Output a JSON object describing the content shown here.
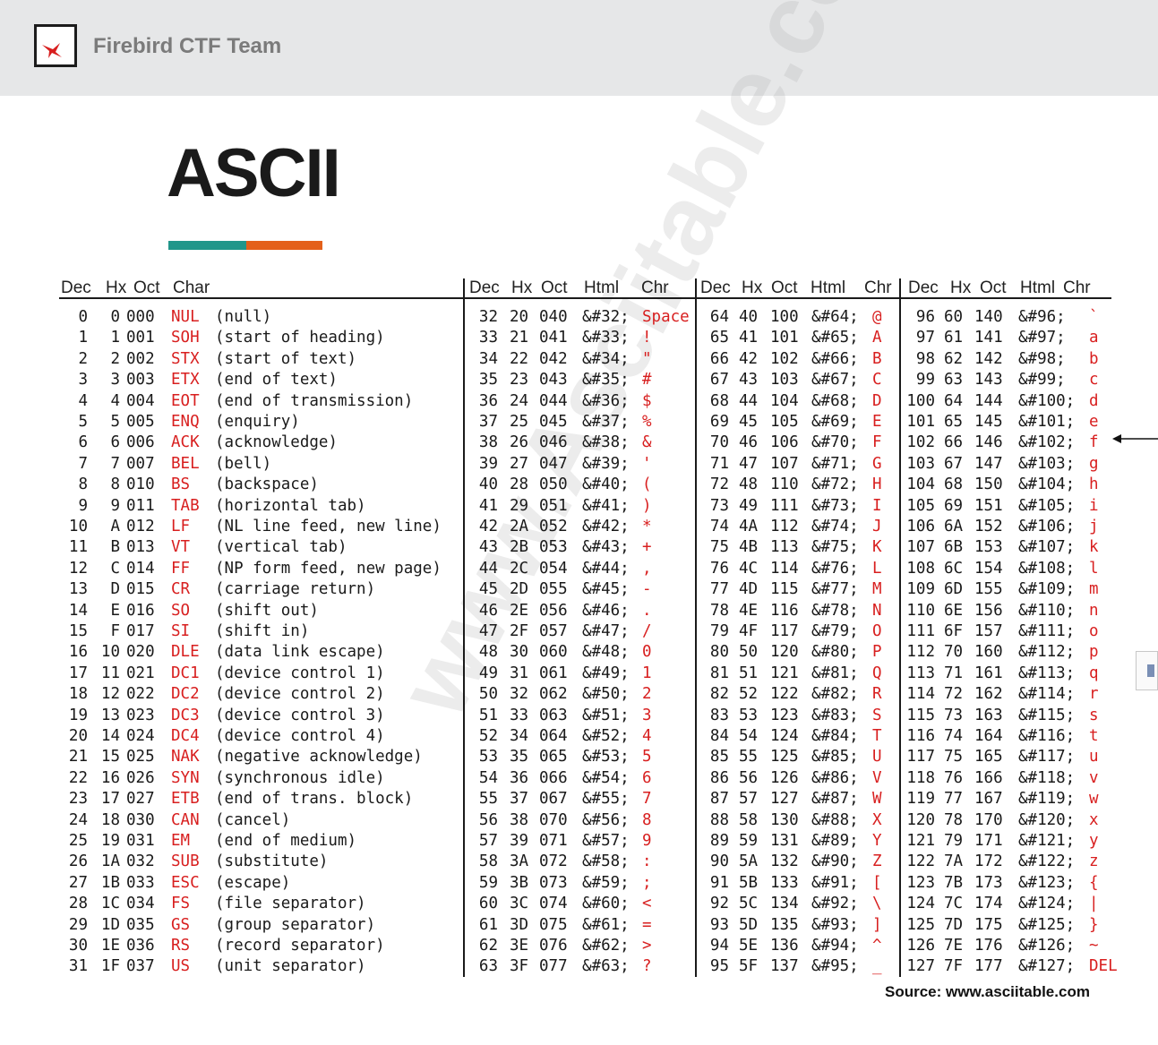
{
  "header": {
    "team_name": "Firebird CTF Team"
  },
  "title": "ASCII",
  "table": {
    "headers": [
      [
        "Dec",
        "Hx",
        "Oct",
        "Char",
        ""
      ],
      [
        "Dec",
        "Hx",
        "Oct",
        "Html",
        "Chr"
      ],
      [
        "Dec",
        "Hx",
        "Oct",
        "Html",
        "Chr"
      ],
      [
        "Dec",
        "Hx",
        "Oct",
        "Html",
        "Chr"
      ]
    ],
    "control": [
      [
        "0",
        "0",
        "000",
        "NUL",
        "(null)"
      ],
      [
        "1",
        "1",
        "001",
        "SOH",
        "(start of heading)"
      ],
      [
        "2",
        "2",
        "002",
        "STX",
        "(start of text)"
      ],
      [
        "3",
        "3",
        "003",
        "ETX",
        "(end of text)"
      ],
      [
        "4",
        "4",
        "004",
        "EOT",
        "(end of transmission)"
      ],
      [
        "5",
        "5",
        "005",
        "ENQ",
        "(enquiry)"
      ],
      [
        "6",
        "6",
        "006",
        "ACK",
        "(acknowledge)"
      ],
      [
        "7",
        "7",
        "007",
        "BEL",
        "(bell)"
      ],
      [
        "8",
        "8",
        "010",
        "BS",
        "(backspace)"
      ],
      [
        "9",
        "9",
        "011",
        "TAB",
        "(horizontal tab)"
      ],
      [
        "10",
        "A",
        "012",
        "LF",
        "(NL line feed, new line)"
      ],
      [
        "11",
        "B",
        "013",
        "VT",
        "(vertical tab)"
      ],
      [
        "12",
        "C",
        "014",
        "FF",
        "(NP form feed, new page)"
      ],
      [
        "13",
        "D",
        "015",
        "CR",
        "(carriage return)"
      ],
      [
        "14",
        "E",
        "016",
        "SO",
        "(shift out)"
      ],
      [
        "15",
        "F",
        "017",
        "SI",
        "(shift in)"
      ],
      [
        "16",
        "10",
        "020",
        "DLE",
        "(data link escape)"
      ],
      [
        "17",
        "11",
        "021",
        "DC1",
        "(device control 1)"
      ],
      [
        "18",
        "12",
        "022",
        "DC2",
        "(device control 2)"
      ],
      [
        "19",
        "13",
        "023",
        "DC3",
        "(device control 3)"
      ],
      [
        "20",
        "14",
        "024",
        "DC4",
        "(device control 4)"
      ],
      [
        "21",
        "15",
        "025",
        "NAK",
        "(negative acknowledge)"
      ],
      [
        "22",
        "16",
        "026",
        "SYN",
        "(synchronous idle)"
      ],
      [
        "23",
        "17",
        "027",
        "ETB",
        "(end of trans. block)"
      ],
      [
        "24",
        "18",
        "030",
        "CAN",
        "(cancel)"
      ],
      [
        "25",
        "19",
        "031",
        "EM",
        "(end of medium)"
      ],
      [
        "26",
        "1A",
        "032",
        "SUB",
        "(substitute)"
      ],
      [
        "27",
        "1B",
        "033",
        "ESC",
        "(escape)"
      ],
      [
        "28",
        "1C",
        "034",
        "FS",
        "(file separator)"
      ],
      [
        "29",
        "1D",
        "035",
        "GS",
        "(group separator)"
      ],
      [
        "30",
        "1E",
        "036",
        "RS",
        "(record separator)"
      ],
      [
        "31",
        "1F",
        "037",
        "US",
        "(unit separator)"
      ]
    ],
    "printable": [
      [
        [
          "32",
          "20",
          "040",
          "&#32;",
          "Space"
        ],
        [
          "33",
          "21",
          "041",
          "&#33;",
          "!"
        ],
        [
          "34",
          "22",
          "042",
          "&#34;",
          "\""
        ],
        [
          "35",
          "23",
          "043",
          "&#35;",
          "#"
        ],
        [
          "36",
          "24",
          "044",
          "&#36;",
          "$"
        ],
        [
          "37",
          "25",
          "045",
          "&#37;",
          "%"
        ],
        [
          "38",
          "26",
          "046",
          "&#38;",
          "&"
        ],
        [
          "39",
          "27",
          "047",
          "&#39;",
          "'"
        ],
        [
          "40",
          "28",
          "050",
          "&#40;",
          "("
        ],
        [
          "41",
          "29",
          "051",
          "&#41;",
          ")"
        ],
        [
          "42",
          "2A",
          "052",
          "&#42;",
          "*"
        ],
        [
          "43",
          "2B",
          "053",
          "&#43;",
          "+"
        ],
        [
          "44",
          "2C",
          "054",
          "&#44;",
          ","
        ],
        [
          "45",
          "2D",
          "055",
          "&#45;",
          "-"
        ],
        [
          "46",
          "2E",
          "056",
          "&#46;",
          "."
        ],
        [
          "47",
          "2F",
          "057",
          "&#47;",
          "/"
        ],
        [
          "48",
          "30",
          "060",
          "&#48;",
          "0"
        ],
        [
          "49",
          "31",
          "061",
          "&#49;",
          "1"
        ],
        [
          "50",
          "32",
          "062",
          "&#50;",
          "2"
        ],
        [
          "51",
          "33",
          "063",
          "&#51;",
          "3"
        ],
        [
          "52",
          "34",
          "064",
          "&#52;",
          "4"
        ],
        [
          "53",
          "35",
          "065",
          "&#53;",
          "5"
        ],
        [
          "54",
          "36",
          "066",
          "&#54;",
          "6"
        ],
        [
          "55",
          "37",
          "067",
          "&#55;",
          "7"
        ],
        [
          "56",
          "38",
          "070",
          "&#56;",
          "8"
        ],
        [
          "57",
          "39",
          "071",
          "&#57;",
          "9"
        ],
        [
          "58",
          "3A",
          "072",
          "&#58;",
          ":"
        ],
        [
          "59",
          "3B",
          "073",
          "&#59;",
          ";"
        ],
        [
          "60",
          "3C",
          "074",
          "&#60;",
          "<"
        ],
        [
          "61",
          "3D",
          "075",
          "&#61;",
          "="
        ],
        [
          "62",
          "3E",
          "076",
          "&#62;",
          ">"
        ],
        [
          "63",
          "3F",
          "077",
          "&#63;",
          "?"
        ]
      ],
      [
        [
          "64",
          "40",
          "100",
          "&#64;",
          "@"
        ],
        [
          "65",
          "41",
          "101",
          "&#65;",
          "A"
        ],
        [
          "66",
          "42",
          "102",
          "&#66;",
          "B"
        ],
        [
          "67",
          "43",
          "103",
          "&#67;",
          "C"
        ],
        [
          "68",
          "44",
          "104",
          "&#68;",
          "D"
        ],
        [
          "69",
          "45",
          "105",
          "&#69;",
          "E"
        ],
        [
          "70",
          "46",
          "106",
          "&#70;",
          "F"
        ],
        [
          "71",
          "47",
          "107",
          "&#71;",
          "G"
        ],
        [
          "72",
          "48",
          "110",
          "&#72;",
          "H"
        ],
        [
          "73",
          "49",
          "111",
          "&#73;",
          "I"
        ],
        [
          "74",
          "4A",
          "112",
          "&#74;",
          "J"
        ],
        [
          "75",
          "4B",
          "113",
          "&#75;",
          "K"
        ],
        [
          "76",
          "4C",
          "114",
          "&#76;",
          "L"
        ],
        [
          "77",
          "4D",
          "115",
          "&#77;",
          "M"
        ],
        [
          "78",
          "4E",
          "116",
          "&#78;",
          "N"
        ],
        [
          "79",
          "4F",
          "117",
          "&#79;",
          "O"
        ],
        [
          "80",
          "50",
          "120",
          "&#80;",
          "P"
        ],
        [
          "81",
          "51",
          "121",
          "&#81;",
          "Q"
        ],
        [
          "82",
          "52",
          "122",
          "&#82;",
          "R"
        ],
        [
          "83",
          "53",
          "123",
          "&#83;",
          "S"
        ],
        [
          "84",
          "54",
          "124",
          "&#84;",
          "T"
        ],
        [
          "85",
          "55",
          "125",
          "&#85;",
          "U"
        ],
        [
          "86",
          "56",
          "126",
          "&#86;",
          "V"
        ],
        [
          "87",
          "57",
          "127",
          "&#87;",
          "W"
        ],
        [
          "88",
          "58",
          "130",
          "&#88;",
          "X"
        ],
        [
          "89",
          "59",
          "131",
          "&#89;",
          "Y"
        ],
        [
          "90",
          "5A",
          "132",
          "&#90;",
          "Z"
        ],
        [
          "91",
          "5B",
          "133",
          "&#91;",
          "["
        ],
        [
          "92",
          "5C",
          "134",
          "&#92;",
          "\\"
        ],
        [
          "93",
          "5D",
          "135",
          "&#93;",
          "]"
        ],
        [
          "94",
          "5E",
          "136",
          "&#94;",
          "^"
        ],
        [
          "95",
          "5F",
          "137",
          "&#95;",
          "_"
        ]
      ],
      [
        [
          "96",
          "60",
          "140",
          "&#96;",
          "`"
        ],
        [
          "97",
          "61",
          "141",
          "&#97;",
          "a"
        ],
        [
          "98",
          "62",
          "142",
          "&#98;",
          "b"
        ],
        [
          "99",
          "63",
          "143",
          "&#99;",
          "c"
        ],
        [
          "100",
          "64",
          "144",
          "&#100;",
          "d"
        ],
        [
          "101",
          "65",
          "145",
          "&#101;",
          "e"
        ],
        [
          "102",
          "66",
          "146",
          "&#102;",
          "f"
        ],
        [
          "103",
          "67",
          "147",
          "&#103;",
          "g"
        ],
        [
          "104",
          "68",
          "150",
          "&#104;",
          "h"
        ],
        [
          "105",
          "69",
          "151",
          "&#105;",
          "i"
        ],
        [
          "106",
          "6A",
          "152",
          "&#106;",
          "j"
        ],
        [
          "107",
          "6B",
          "153",
          "&#107;",
          "k"
        ],
        [
          "108",
          "6C",
          "154",
          "&#108;",
          "l"
        ],
        [
          "109",
          "6D",
          "155",
          "&#109;",
          "m"
        ],
        [
          "110",
          "6E",
          "156",
          "&#110;",
          "n"
        ],
        [
          "111",
          "6F",
          "157",
          "&#111;",
          "o"
        ],
        [
          "112",
          "70",
          "160",
          "&#112;",
          "p"
        ],
        [
          "113",
          "71",
          "161",
          "&#113;",
          "q"
        ],
        [
          "114",
          "72",
          "162",
          "&#114;",
          "r"
        ],
        [
          "115",
          "73",
          "163",
          "&#115;",
          "s"
        ],
        [
          "116",
          "74",
          "164",
          "&#116;",
          "t"
        ],
        [
          "117",
          "75",
          "165",
          "&#117;",
          "u"
        ],
        [
          "118",
          "76",
          "166",
          "&#118;",
          "v"
        ],
        [
          "119",
          "77",
          "167",
          "&#119;",
          "w"
        ],
        [
          "120",
          "78",
          "170",
          "&#120;",
          "x"
        ],
        [
          "121",
          "79",
          "171",
          "&#121;",
          "y"
        ],
        [
          "122",
          "7A",
          "172",
          "&#122;",
          "z"
        ],
        [
          "123",
          "7B",
          "173",
          "&#123;",
          "{"
        ],
        [
          "124",
          "7C",
          "174",
          "&#124;",
          "|"
        ],
        [
          "125",
          "7D",
          "175",
          "&#125;",
          "}"
        ],
        [
          "126",
          "7E",
          "176",
          "&#126;",
          "~"
        ],
        [
          "127",
          "7F",
          "177",
          "&#127;",
          "DEL"
        ]
      ]
    ]
  },
  "watermark": "www.Asciitable.com",
  "source": "Source: www.asciitable.com",
  "colors": {
    "accent_teal": "#21968a",
    "accent_orange": "#e4601a",
    "char_red": "#d81f1f",
    "header_bg": "#e6e7e8"
  },
  "icons": {
    "logo": "firebird-logo-icon",
    "pointer": "arrow-left-icon"
  }
}
